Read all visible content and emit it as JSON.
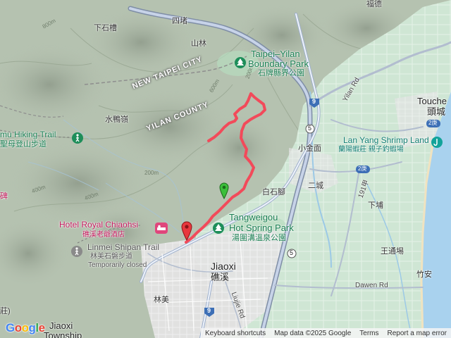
{
  "map": {
    "places": {
      "xiashicao": "下石槽",
      "sidu": "四堵",
      "shanlin": "山林",
      "shuiyalin": "水鴨嶺",
      "new_taipei": "NEW TAIPEI CITY",
      "yilan_county": "YILAN COUNTY",
      "xiaojinmian": "小金面",
      "erjie": "二城",
      "baishijiao": "白石腳",
      "xiapu": "下埔",
      "wangtongchang": "王通埸",
      "zhuan": "竹安",
      "toucheng_en": "Touche",
      "toucheng_cn": "頭城",
      "jiaoxi_en": "Jiaoxi",
      "jiaoxi_cn": "礁溪",
      "linmei": "林美",
      "jiaoxi_township_1": "Jiaoxi",
      "jiaoxi_township_2": "Township",
      "left_edge_1": "碑",
      "left_edge_2": "莊)",
      "top_right": "福德"
    },
    "pois": {
      "boundary_park_en1": "Taipei–Yilan",
      "boundary_park_en2": "Boundary Park",
      "boundary_park_cn": "石牌縣界公園",
      "tangweigou_en1": "Tangweigou",
      "tangweigou_en2": "Hot Spring Park",
      "tangweigou_cn": "湯圍溝溫泉公園",
      "shrimp_en": "Lan Yang Shrimp Land",
      "shrimp_cn": "蘭陽蝦莊 親子釣蝦場",
      "hotel_en": "Hotel Royal Chiaohsi",
      "hotel_cn": "礁溪老爺酒店",
      "linmei_trail_en": "Linmei Shipan Trail",
      "linmei_trail_cn": "林美石磐步道",
      "linmei_trail_status": "Temporarily closed",
      "hiking_trail_en": "mu Hiking Trail",
      "hiking_trail_cn": "聖母登山步道"
    },
    "roads": {
      "yilan_rd": "Yilan Rd",
      "dawen_rd": "Dawen Rd",
      "liujie_rd": "Liujie Rd",
      "rd_191": "191甲",
      "shield_9": "9",
      "shield_5": "5",
      "shield_2": "2",
      "shield_2_lower": "5",
      "shield_9_bottom": "9",
      "hwy_2_label": "2",
      "hwy_2jia": "2庚",
      "hwy_2jia_b": "2庚"
    },
    "contours": {
      "c1": "800m",
      "c2": "600m",
      "c3": "400m",
      "c4": "400m",
      "c5": "200m",
      "c6": "200m"
    },
    "route": {
      "start_marker": "green",
      "end_marker": "red",
      "color": "#f24a5a"
    }
  },
  "footer": {
    "shortcuts": "Keyboard shortcuts",
    "map_data": "Map data ©2025 Google",
    "terms": "Terms",
    "report": "Report a map error"
  },
  "logo": {
    "text": "Google"
  }
}
